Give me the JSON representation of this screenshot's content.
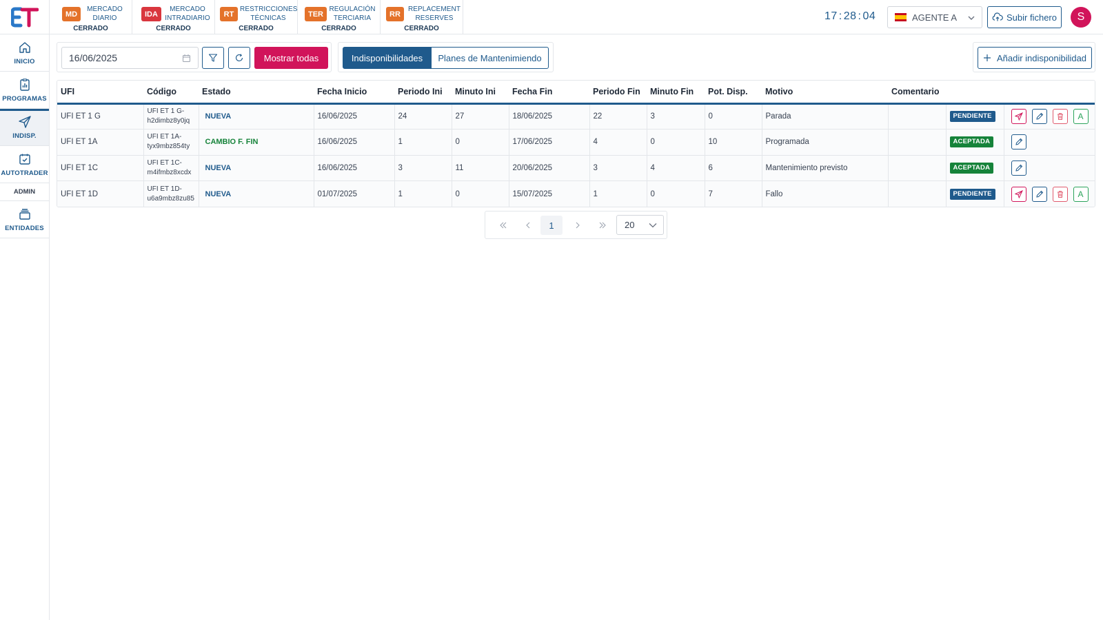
{
  "app": {
    "logo": "ET"
  },
  "markets": [
    {
      "code": "MD",
      "name_line1": "MERCADO",
      "name_line2": "DIARIO",
      "state": "CERRADO",
      "color": "#e4722a"
    },
    {
      "code": "IDA",
      "name_line1": "MERCADO",
      "name_line2": "INTRADIARIO",
      "state": "CERRADO",
      "color": "#d9363e"
    },
    {
      "code": "RT",
      "name_line1": "RESTRICCIONES",
      "name_line2": "TÉCNICAS",
      "state": "CERRADO",
      "color": "#e4722a"
    },
    {
      "code": "TER",
      "name_line1": "REGULACIÓN",
      "name_line2": "TERCIARIA",
      "state": "CERRADO",
      "color": "#e4722a"
    },
    {
      "code": "RR",
      "name_line1": "REPLACEMENT",
      "name_line2": "RESERVES",
      "state": "CERRADO",
      "color": "#e4722a"
    }
  ],
  "clock": {
    "h": "17",
    "m": "28",
    "s": "04"
  },
  "agent": {
    "label": "AGENTE A"
  },
  "upload": {
    "label": "Subir fichero"
  },
  "user": {
    "initial": "S"
  },
  "sidebar": {
    "items": [
      {
        "label": "INICIO"
      },
      {
        "label": "PROGRAMAS"
      },
      {
        "label": "INDISP."
      },
      {
        "label": "AUTOTRADER"
      }
    ],
    "section": "ADMIN",
    "admin_items": [
      {
        "label": "ENTIDADES"
      }
    ]
  },
  "toolbar": {
    "date_value": "16/06/2025",
    "show_all_label": "Mostrar todas",
    "tabs": [
      {
        "label": "Indisponibilidades"
      },
      {
        "label": "Planes de Mantenimiendo"
      }
    ],
    "add_label": "Añadir indisponibilidad"
  },
  "table": {
    "headers": [
      "UFI",
      "Código",
      "Estado",
      "Fecha Inicio",
      "Periodo Ini",
      "Minuto Ini",
      "Fecha Fin",
      "Periodo Fin",
      "Minuto Fin",
      "Pot. Disp.",
      "Motivo",
      "Comentario",
      "",
      ""
    ],
    "rows": [
      {
        "ufi": "UFI ET 1 G",
        "code_l1": "UFI ET 1 G-",
        "code_l2": "h2dimbz8y0jq",
        "estado": "NUEVA",
        "fecha_ini": "16/06/2025",
        "periodo_ini": "24",
        "minuto_ini": "27",
        "fecha_fin": "18/06/2025",
        "periodo_fin": "22",
        "minuto_fin": "3",
        "pot": "0",
        "motivo": "Parada",
        "comentario": "",
        "status": "PENDIENTE"
      },
      {
        "ufi": "UFI ET 1A",
        "code_l1": "UFI ET 1A-",
        "code_l2": "tyx9mbz854ty",
        "estado": "CAMBIO F. FIN",
        "fecha_ini": "16/06/2025",
        "periodo_ini": "1",
        "minuto_ini": "0",
        "fecha_fin": "17/06/2025",
        "periodo_fin": "4",
        "minuto_fin": "0",
        "pot": "10",
        "motivo": "Programada",
        "comentario": "",
        "status": "ACEPTADA"
      },
      {
        "ufi": "UFI ET 1C",
        "code_l1": "UFI ET 1C-",
        "code_l2": "m4ifmbz8xcdx",
        "estado": "NUEVA",
        "fecha_ini": "16/06/2025",
        "periodo_ini": "3",
        "minuto_ini": "11",
        "fecha_fin": "20/06/2025",
        "periodo_fin": "3",
        "minuto_fin": "4",
        "pot": "6",
        "motivo": "Mantenimiento previsto",
        "comentario": "",
        "status": "ACEPTADA"
      },
      {
        "ufi": "UFI ET 1D",
        "code_l1": "UFI ET 1D-",
        "code_l2": "u6a9mbz8zu85",
        "estado": "NUEVA",
        "fecha_ini": "01/07/2025",
        "periodo_ini": "1",
        "minuto_ini": "0",
        "fecha_fin": "15/07/2025",
        "periodo_fin": "1",
        "minuto_fin": "0",
        "pot": "7",
        "motivo": "Fallo",
        "comentario": "",
        "status": "PENDIENTE"
      }
    ]
  },
  "pagination": {
    "current": "1",
    "page_size": "20"
  },
  "colors": {
    "primary": "#1f5a8c",
    "accent": "#d1145a",
    "success": "#16833a"
  }
}
